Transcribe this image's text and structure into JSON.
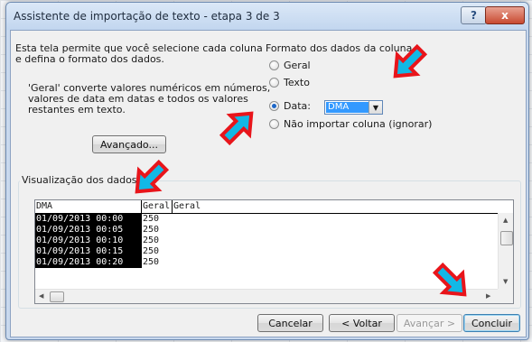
{
  "window": {
    "title": "Assistente de importação de texto - etapa 3 de 3",
    "help_label": "?",
    "close_label": "x"
  },
  "intro": {
    "line1": "Esta tela permite que você selecione cada coluna",
    "line2": "e defina o formato dos dados."
  },
  "general_info": {
    "line1": "'Geral' converte valores numéricos em números,",
    "line2": "valores de data em datas e todos os valores",
    "line3": "restantes em texto."
  },
  "advanced_button": "Avançado...",
  "column_format": {
    "title": "Formato dos dados da coluna",
    "options": [
      {
        "label": "Geral",
        "checked": false
      },
      {
        "label": "Texto",
        "checked": false
      },
      {
        "label": "Data:",
        "checked": true
      },
      {
        "label": "Não importar coluna (ignorar)",
        "checked": false
      }
    ],
    "date_format": "DMA"
  },
  "preview": {
    "title": "Visualização dos dados",
    "headers": [
      "DMA",
      "Geral",
      "Geral"
    ],
    "rows": [
      [
        "01/09/2013 00:00",
        "250"
      ],
      [
        "01/09/2013 00:05",
        "250"
      ],
      [
        "01/09/2013 00:10",
        "250"
      ],
      [
        "01/09/2013 00:15",
        "250"
      ],
      [
        "01/09/2013 00:20",
        "250"
      ]
    ]
  },
  "buttons": {
    "cancel": "Cancelar",
    "back": "< Voltar",
    "next": "Avançar >",
    "finish": "Concluir"
  },
  "colors": {
    "arrow_fill": "#12b8e6",
    "arrow_border": "#e8151b",
    "selection": "#000000",
    "dropdown_highlight": "#3399ff"
  }
}
